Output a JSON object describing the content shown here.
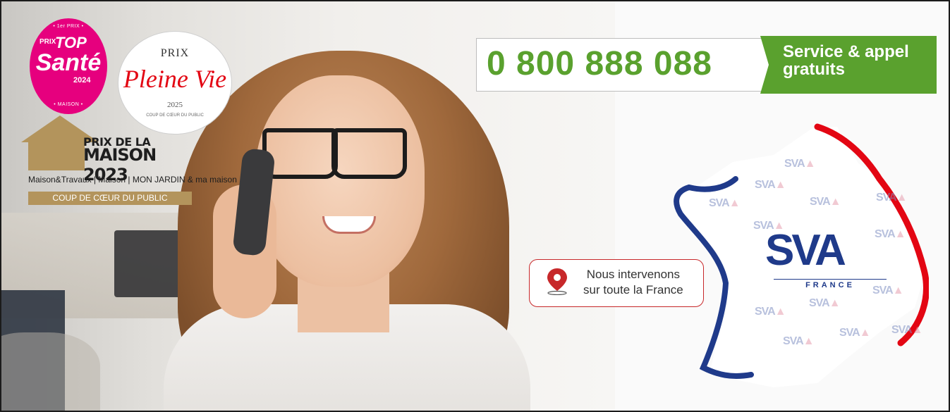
{
  "badges": {
    "top_sante": {
      "rank": "• 1er PRIX •",
      "prix": "PRIX",
      "top": "TOP",
      "sante": "Santé",
      "year": "2024",
      "category": "• MAISON •"
    },
    "pleine_vie": {
      "prix": "PRIX",
      "title": "Pleine Vie",
      "year": "2025",
      "subtitle": "COUP DE CŒUR DU PUBLIC"
    },
    "maison": {
      "line1": "PRIX DE LA",
      "line2": "MAISON 2023",
      "partners": "Maison&Travaux | Maison | MON JARDIN & ma maison",
      "coup": "COUP DE CŒUR DU PUBLIC"
    }
  },
  "contact": {
    "phone": "0 800 888 088",
    "service_line1": "Service & appel",
    "service_line2": "gratuits"
  },
  "location": {
    "line1": "Nous intervenons",
    "line2": "sur toute la France"
  },
  "brand": {
    "name": "SVA",
    "country": "FRANCE",
    "colors": {
      "green": "#5aa12e",
      "blue": "#1f3a8a",
      "red": "#e30613",
      "pink": "#e6007e",
      "gold": "#b3945c"
    }
  },
  "icons": [
    "location-pin-icon",
    "house-icon"
  ]
}
